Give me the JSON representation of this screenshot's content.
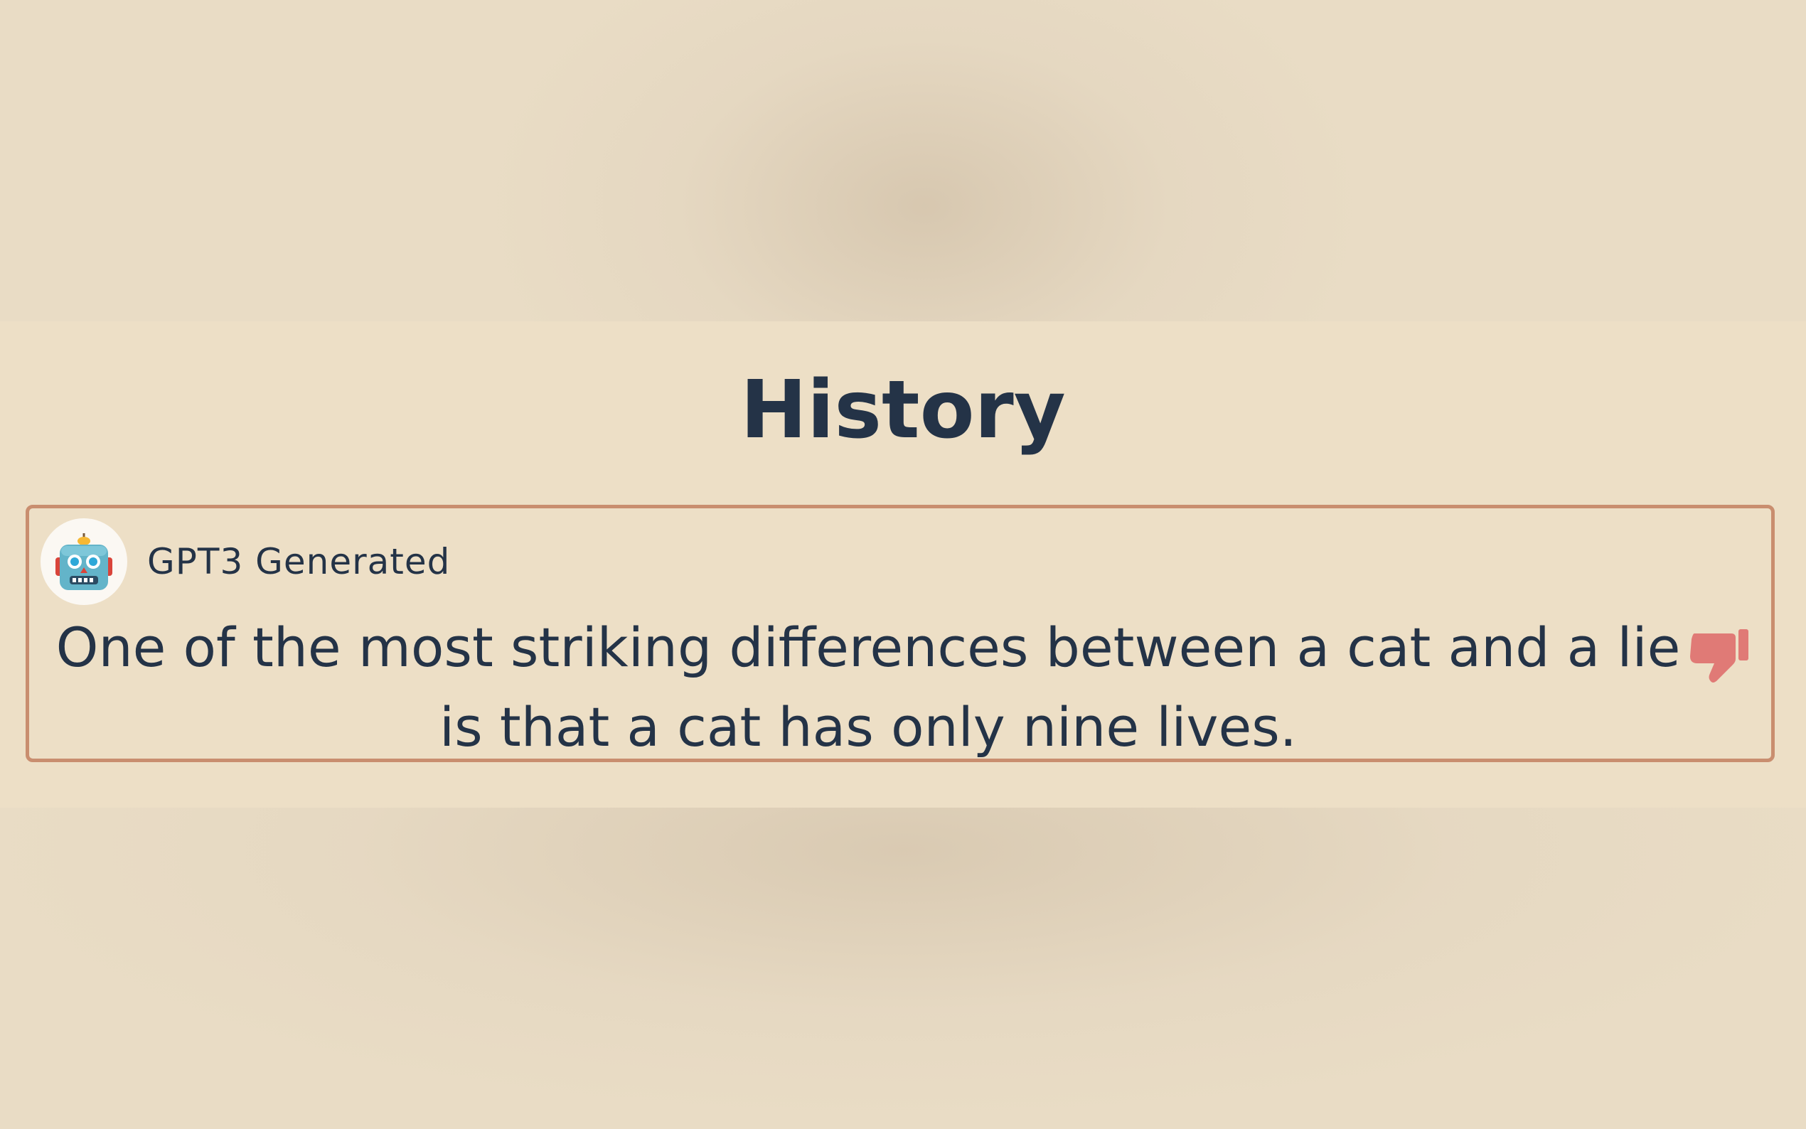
{
  "page": {
    "title": "History"
  },
  "history": {
    "items": [
      {
        "author": "GPT3 Generated",
        "avatar_icon": "robot-icon",
        "message": "One of the most striking differences between a cat and a lie is that a cat has only nine lives.",
        "feedback_icon": "thumbs-down-icon",
        "feedback_color": "#e07a76"
      }
    ]
  },
  "colors": {
    "background": "#e9dcc5",
    "panel": "#eddfc6",
    "text": "#243347",
    "card_border": "#c98e6f"
  }
}
